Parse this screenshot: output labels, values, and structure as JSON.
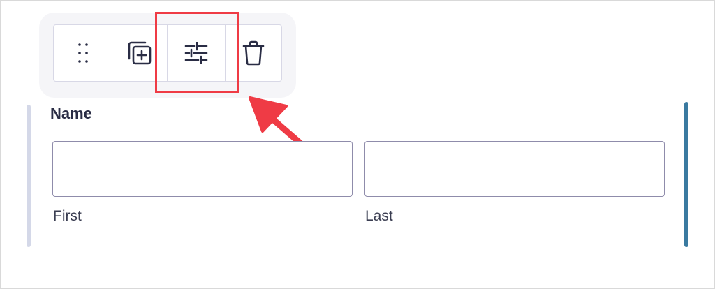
{
  "toolbar": {
    "buttons": [
      {
        "name": "drag-handle",
        "icon": "drag-dots-icon"
      },
      {
        "name": "duplicate",
        "icon": "duplicate-icon"
      },
      {
        "name": "field-settings",
        "icon": "sliders-icon"
      },
      {
        "name": "delete",
        "icon": "trash-icon"
      }
    ]
  },
  "field": {
    "label": "Name",
    "inputs": {
      "first": {
        "value": "",
        "sublabel": "First"
      },
      "last": {
        "value": "",
        "sublabel": "Last"
      }
    }
  },
  "colors": {
    "highlight": "#ef3b45",
    "active_rail": "#3a7aa0",
    "inactive_rail": "#d4d8e8",
    "input_border": "#8f8cab",
    "label_text": "#2a2d45"
  }
}
